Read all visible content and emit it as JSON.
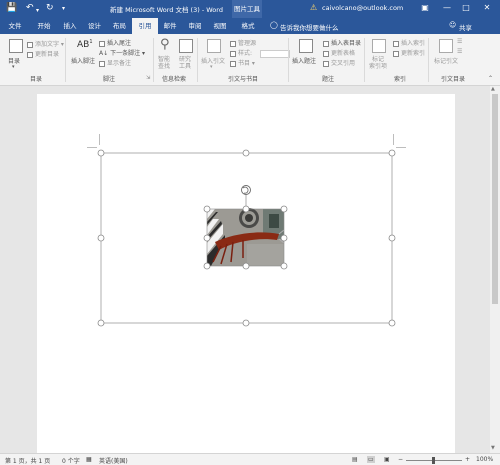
{
  "title_bar": {
    "save_icon": "save-icon",
    "undo_icon": "undo-icon",
    "redo_icon": "redo-icon",
    "customize_icon": "customize-quick-access-icon",
    "title": "新建 Microsoft Word 文档 (3) - Word",
    "context_tool_group": "图片工具",
    "account_warning_icon": "warning-icon",
    "account": "caivolcano@outlook.com",
    "ribbon_display_icon": "ribbon-display-icon",
    "minimize": "—",
    "maximize": "□",
    "close": "✕"
  },
  "tabs": [
    "文件",
    "开始",
    "插入",
    "设计",
    "布局",
    "引用",
    "邮件",
    "审阅",
    "视图",
    "格式"
  ],
  "active_tab": "引用",
  "tell_me": "告诉我你想要做什么",
  "share": "共享",
  "ribbon": {
    "toc": {
      "button": "目录",
      "add_text": "添加文字",
      "update_toc": "更新目录",
      "label": "目录"
    },
    "footnotes": {
      "insert_footnote": "插入脚注",
      "insert_endnote": "插入尾注",
      "next_footnote": "下一条脚注",
      "show_notes": "显示备注",
      "label": "脚注"
    },
    "research": {
      "smart_lookup": "智能\n查找",
      "researcher": "研究\n工具",
      "label": "信息检索"
    },
    "citations": {
      "insert_citation": "插入引文",
      "manage_sources": "管理源",
      "style_label": "样式:",
      "style_value": "",
      "bibliography": "书目",
      "label": "引文与书目"
    },
    "captions": {
      "insert_caption": "插入题注",
      "insert_table_of_figures": "插入表目录",
      "update_table": "更新表格",
      "cross_reference": "交叉引用",
      "label": "题注"
    },
    "index": {
      "mark_entry": "标记\n索引项",
      "insert_index": "插入索引",
      "update_index": "更新索引",
      "label": "索引"
    },
    "authorities": {
      "mark_citation": "标记引文",
      "label": "引文目录"
    }
  },
  "status_bar": {
    "page": "第 1 页，共 1 页",
    "words": "0 个字",
    "language": "英语(美国)",
    "zoom": "100%"
  },
  "zoom_level": 100,
  "image_colors": {
    "photo_background": "#9c9a94",
    "lobster": "#8a2a14",
    "accent": "#2b579a"
  }
}
